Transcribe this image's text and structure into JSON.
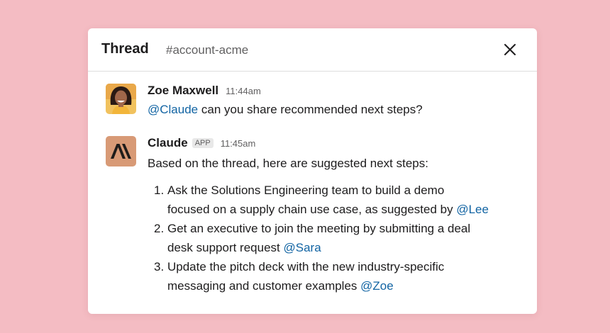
{
  "header": {
    "title": "Thread",
    "channel": "#account-acme"
  },
  "icons": {
    "close": "close-icon"
  },
  "messages": [
    {
      "author": "Zoe Maxwell",
      "time": "11:44am",
      "mention": "@Claude",
      "text": " can you share recommended next steps?"
    },
    {
      "author": "Claude",
      "badge": "APP",
      "time": "11:45am",
      "intro": "Based on the thread, here are suggested next steps:",
      "steps": [
        {
          "num": "1.",
          "line1": "Ask the Solutions Engineering team to build a demo",
          "line2_text": "focused on a supply chain use case, as suggested by ",
          "mention": "@Lee"
        },
        {
          "num": "2.",
          "line1": "Get an executive to join the meeting by submitting a deal",
          "line2_text": "desk support request ",
          "mention": "@Sara"
        },
        {
          "num": "3.",
          "line1": "Update the pitch deck with the new industry-specific",
          "line2_text": "messaging and customer examples ",
          "mention": "@Zoe"
        }
      ]
    }
  ],
  "colors": {
    "background": "#f4bcc3",
    "mention": "#1264a3",
    "claude_avatar": "#d89a76"
  }
}
